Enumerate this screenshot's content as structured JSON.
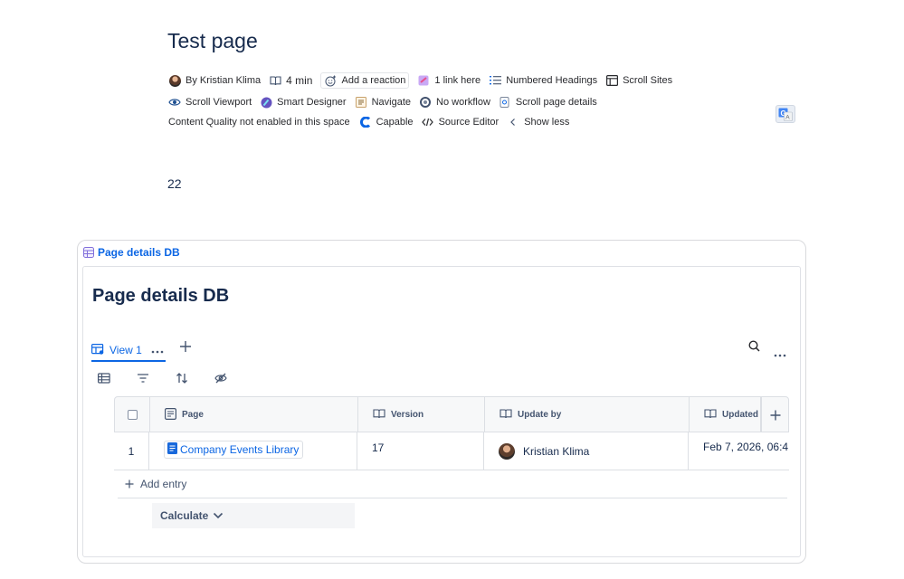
{
  "page": {
    "title": "Test page",
    "body_number": "22"
  },
  "byline": {
    "author": "By Kristian Klima",
    "read_time": "4 min",
    "reaction": "Add a reaction",
    "links": "1 link here",
    "numbered_headings": "Numbered Headings",
    "scroll_sites": "Scroll Sites",
    "scroll_viewport": "Scroll Viewport",
    "smart_designer": "Smart Designer",
    "navigate": "Navigate",
    "workflow": "No workflow",
    "scroll_page_details": "Scroll page details",
    "content_quality": "Content Quality not enabled in this space",
    "capable": "Capable",
    "source_editor": "Source Editor",
    "show_less": "Show less"
  },
  "database": {
    "link_label": "Page details DB",
    "title": "Page details DB",
    "active_view": "View 1",
    "columns": [
      "Page",
      "Version",
      "Update by",
      "Updated"
    ],
    "rows": [
      {
        "index": "1",
        "page": "Company Events Library",
        "version": "17",
        "update_by": "Kristian Klima",
        "updated": "Feb 7, 2026, 06:4"
      }
    ],
    "add_entry": "Add entry",
    "calculate": "Calculate"
  },
  "icons": {
    "author": "avatar",
    "read_time": "book-icon",
    "reaction": "smiley-plus-icon",
    "links": "link-app-icon",
    "numbered_headings": "numbered-list-icon",
    "scroll_sites": "layout-icon",
    "scroll_viewport": "eye-icon",
    "smart_designer": "designer-icon",
    "navigate": "navigate-icon",
    "workflow": "workflow-icon",
    "scroll_page_details": "page-details-icon",
    "capable": "capable-icon",
    "source_editor": "code-icon",
    "show_less": "chevron-left-icon"
  },
  "colors": {
    "accent": "#0c66e4",
    "text": "#172b4d",
    "muted": "#44546f",
    "border": "#dcdfe4"
  }
}
